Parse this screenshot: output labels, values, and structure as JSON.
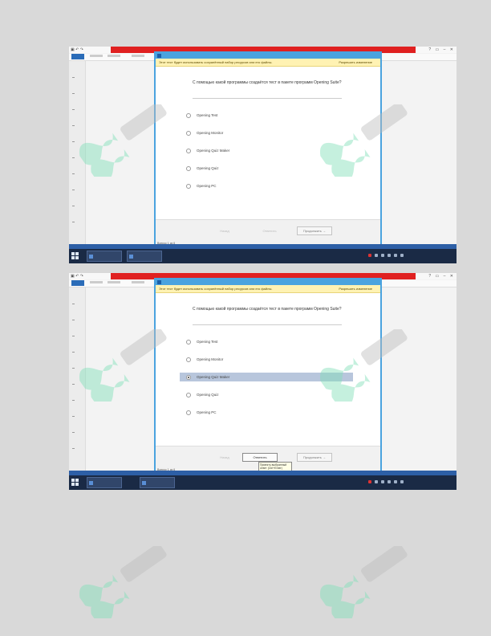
{
  "screens": [
    {
      "warning": "Этот тест будет использовать сохранённый набор ресурсов или его файлы.",
      "allow_label": "Разрешить изменение",
      "question": "С помощью какой программы создаётся тест в пакете программ Opening Suite?",
      "options": [
        {
          "label": "Opening Test",
          "selected": false
        },
        {
          "label": "Opening Monitor",
          "selected": false
        },
        {
          "label": "Opening Quiz Maker",
          "selected": false
        },
        {
          "label": "Opening Quiz",
          "selected": false
        },
        {
          "label": "Opening PC",
          "selected": false
        }
      ],
      "buttons": {
        "back": "Назад",
        "answer": "Ответить",
        "next": "Продолжить →"
      },
      "dialog_status": "Вопрос 1 из 6"
    },
    {
      "warning": "Этот тест будет использовать сохранённый набор ресурсов или его файлы.",
      "allow_label": "Разрешить изменение",
      "question": "С помощью какой программы создаётся тест в пакете программ Opening Suite?",
      "options": [
        {
          "label": "Opening Test",
          "selected": false
        },
        {
          "label": "Opening Monitor",
          "selected": false
        },
        {
          "label": "Opening Quiz Maker",
          "selected": true
        },
        {
          "label": "Opening Quiz",
          "selected": false
        },
        {
          "label": "Opening PC",
          "selected": false
        }
      ],
      "buttons": {
        "back": "Назад",
        "answer": "Ответить",
        "next": "Продолжить →"
      },
      "tooltip": "Принять выбранный ответ (Ctrl+Enter)",
      "dialog_status": "Вопрос 1 из 6"
    }
  ]
}
